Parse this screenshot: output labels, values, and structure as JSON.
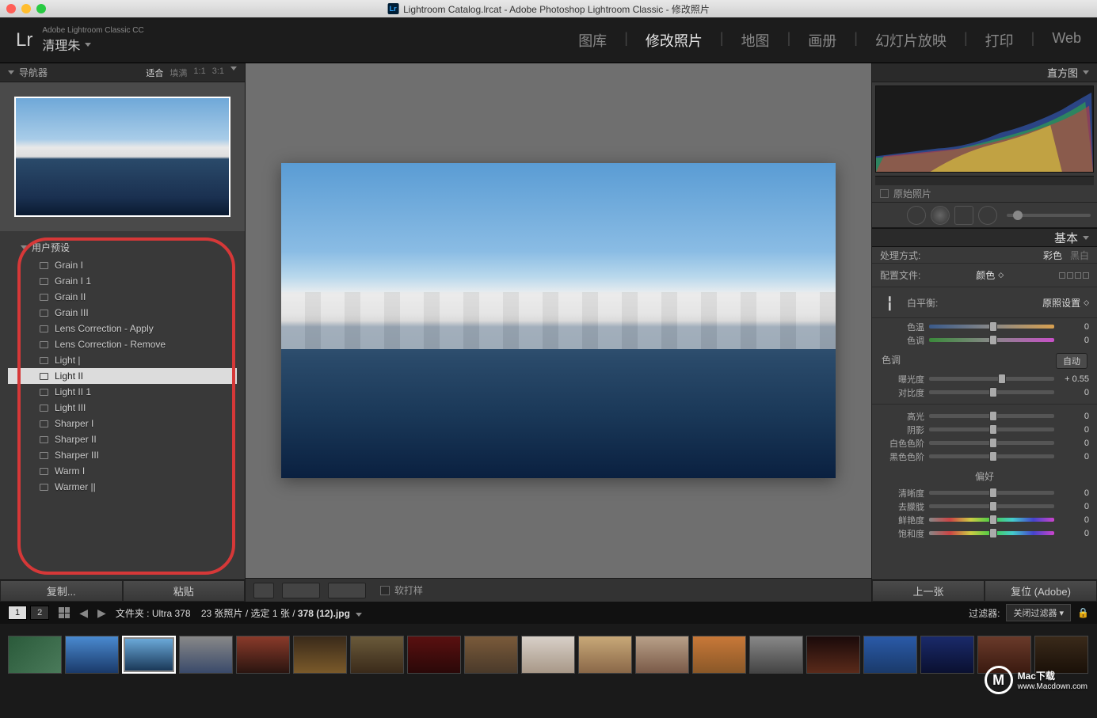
{
  "titlebar": "Lightroom Catalog.lrcat - Adobe Photoshop Lightroom Classic - 修改照片",
  "brand": {
    "logo": "Lr",
    "sub": "Adobe Lightroom Classic CC",
    "name": "清理朱"
  },
  "modules": [
    "图库",
    "修改照片",
    "地图",
    "画册",
    "幻灯片放映",
    "打印",
    "Web"
  ],
  "active_module": "修改照片",
  "navigator": {
    "title": "导航器",
    "options": [
      "适合",
      "填满",
      "1:1",
      "3:1"
    ],
    "selected": "适合"
  },
  "presets": {
    "header": "用户预设",
    "items": [
      "Grain I",
      "Grain I 1",
      "Grain II",
      "Grain III",
      "Lens Correction - Apply",
      "Lens Correction - Remove",
      "Light |",
      "Light II",
      "Light II 1",
      "Light III",
      "Sharper I",
      "Sharper II",
      "Sharper III",
      "Warm I",
      "Warmer ||"
    ],
    "selected": "Light II"
  },
  "left_buttons": {
    "copy": "复制...",
    "paste": "粘贴"
  },
  "soft_proof": "软打样",
  "right": {
    "histogram": "直方图",
    "original": "原始照片",
    "basic": "基本",
    "treatment": {
      "label": "处理方式:",
      "color": "彩色",
      "bw": "黑白"
    },
    "profile": {
      "label": "配置文件:",
      "value": "颜色"
    },
    "wb": {
      "label": "白平衡:",
      "value": "原照设置"
    },
    "sliders": {
      "temp": {
        "label": "色温",
        "val": "0"
      },
      "tint": {
        "label": "色调",
        "val": "0"
      },
      "tone_hdr": "色调",
      "auto": "自动",
      "exposure": {
        "label": "曝光度",
        "val": "+ 0.55"
      },
      "contrast": {
        "label": "对比度",
        "val": "0"
      },
      "highlights": {
        "label": "高光",
        "val": "0"
      },
      "shadows": {
        "label": "阴影",
        "val": "0"
      },
      "whites": {
        "label": "白色色阶",
        "val": "0"
      },
      "blacks": {
        "label": "黑色色阶",
        "val": "0"
      },
      "presence_hdr": "偏好",
      "clarity": {
        "label": "清晰度",
        "val": "0"
      },
      "dehaze": {
        "label": "去朦胧",
        "val": "0"
      },
      "vibrance": {
        "label": "鲜艳度",
        "val": "0"
      },
      "saturation": {
        "label": "饱和度",
        "val": "0"
      }
    }
  },
  "right_buttons": {
    "prev": "上一张",
    "reset": "复位 (Adobe)"
  },
  "secondary": {
    "path_prefix": "文件夹 : Ultra 378",
    "count": "23 张照片 / 选定 1 张 /",
    "filename": "378 (12).jpg",
    "filter_label": "过滤器:",
    "filter_value": "关闭过滤器"
  },
  "thumbs": [
    "linear-gradient(135deg,#2a5a3a,#4a7a5a)",
    "linear-gradient(#4a8ad0,#1a3a6a)",
    "linear-gradient(#6aa8d8,#1a3858)",
    "linear-gradient(#888,#3a4a6a)",
    "linear-gradient(#8a3a2a,#2a1510)",
    "linear-gradient(#3a2a1a,#7a5a2a)",
    "linear-gradient(#6a5a3a,#3a2a1a)",
    "linear-gradient(#5a1010,#2a0808)",
    "linear-gradient(#7a5a3a,#4a3a2a)",
    "linear-gradient(#d8d0c8,#a89888)",
    "linear-gradient(#c8a878,#8a6848)",
    "linear-gradient(#b8a088,#7a5a48)",
    "linear-gradient(#c87838,#8a5828)",
    "linear-gradient(#888,#444)",
    "linear-gradient(#1a0a0a,#5a2a1a)",
    "linear-gradient(#2a5aa8,#1a3a6a)",
    "linear-gradient(#1a2a6a,#0a1030)",
    "linear-gradient(#6a3a2a,#3a1a10)",
    "linear-gradient(#3a2a1a,#1a1008)"
  ],
  "watermark": {
    "brand": "Mac下载",
    "url": "www.Macdown.com"
  }
}
